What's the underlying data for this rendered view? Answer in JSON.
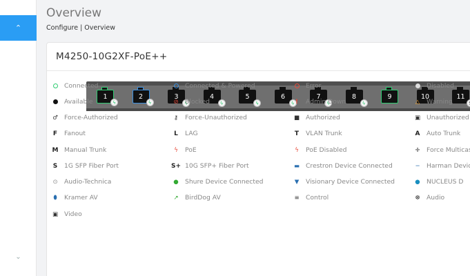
{
  "page": {
    "title": "Overview",
    "breadcrumb": "Configure | Overview"
  },
  "sidebar": {
    "active_icon": "chevron-up-icon",
    "bottom_icon": "chevron-down-icon"
  },
  "device": {
    "model": "M4250-10G2XF-PoE++"
  },
  "ports": [
    {
      "label": "1",
      "status": "green",
      "poe": true
    },
    {
      "label": "2",
      "status": "blue",
      "poe": true
    },
    {
      "label": "3",
      "status": "none",
      "poe": true
    },
    {
      "label": "4",
      "status": "none",
      "poe": true
    },
    {
      "label": "5",
      "status": "none",
      "poe": true
    },
    {
      "label": "6",
      "status": "none",
      "poe": true
    },
    {
      "label": "7",
      "status": "none",
      "poe": true
    },
    {
      "label": "8",
      "status": "none",
      "poe": true
    },
    {
      "label": "9",
      "status": "green",
      "poe": false
    },
    {
      "label": "10",
      "status": "none",
      "poe": false
    },
    {
      "label": "11",
      "status": "none",
      "poe": false
    }
  ],
  "port_11_badge": "S",
  "legend": [
    {
      "label": "Connected",
      "icon": "ring-green-icon"
    },
    {
      "label": "Connected & Powered",
      "icon": "ring-blue-icon"
    },
    {
      "label": "Error",
      "icon": "ring-red-icon"
    },
    {
      "label": "Disabled",
      "icon": "disabled-dot-icon"
    },
    {
      "label": "Available",
      "icon": "filled-dot-icon"
    },
    {
      "label": "Blocked",
      "icon": "blocked-icon"
    },
    {
      "label": "Admin Down",
      "icon": "exclamation-icon"
    },
    {
      "label": "Warning",
      "icon": "warning-icon"
    },
    {
      "label": "Force-Authorized",
      "icon": "key-icon"
    },
    {
      "label": "Force-Unauthorized",
      "icon": "key-slash-icon"
    },
    {
      "label": "Authorized",
      "icon": "unlock-icon"
    },
    {
      "label": "Unauthorized",
      "icon": "lock-icon"
    },
    {
      "label": "Fanout",
      "icon": "F"
    },
    {
      "label": "LAG",
      "icon": "L"
    },
    {
      "label": "VLAN Trunk",
      "icon": "T"
    },
    {
      "label": "Auto Trunk",
      "icon": "A"
    },
    {
      "label": "Manual Trunk",
      "icon": "M"
    },
    {
      "label": "PoE",
      "icon": "poe-bolt-icon"
    },
    {
      "label": "PoE Disabled",
      "icon": "poe-disabled-icon"
    },
    {
      "label": "Force Multicast",
      "icon": "move-icon"
    },
    {
      "label": "1G SFP Fiber Port",
      "icon": "S"
    },
    {
      "label": "10G SFP+ Fiber Port",
      "icon": "S+"
    },
    {
      "label": "Crestron Device Connected",
      "icon": "crestron-icon"
    },
    {
      "label": "Harman Device",
      "icon": "harman-icon"
    },
    {
      "label": "Audio-Technica",
      "icon": "audio-technica-icon"
    },
    {
      "label": "Shure Device Connected",
      "icon": "shure-icon"
    },
    {
      "label": "Visionary Device Connected",
      "icon": "visionary-icon"
    },
    {
      "label": "NUCLEUS D",
      "icon": "nucleus-icon"
    },
    {
      "label": "Kramer AV",
      "icon": "kramer-icon"
    },
    {
      "label": "BirdDog AV",
      "icon": "birddog-icon"
    },
    {
      "label": "Control",
      "icon": "sliders-icon"
    },
    {
      "label": "Audio",
      "icon": "microphone-icon"
    },
    {
      "label": "Video",
      "icon": "video-icon"
    }
  ],
  "colors": {
    "accent": "#2a9df4",
    "connected": "#2ecc71",
    "powered": "#3a8fe0",
    "error": "#e74c3c",
    "warning": "#f0a030"
  }
}
